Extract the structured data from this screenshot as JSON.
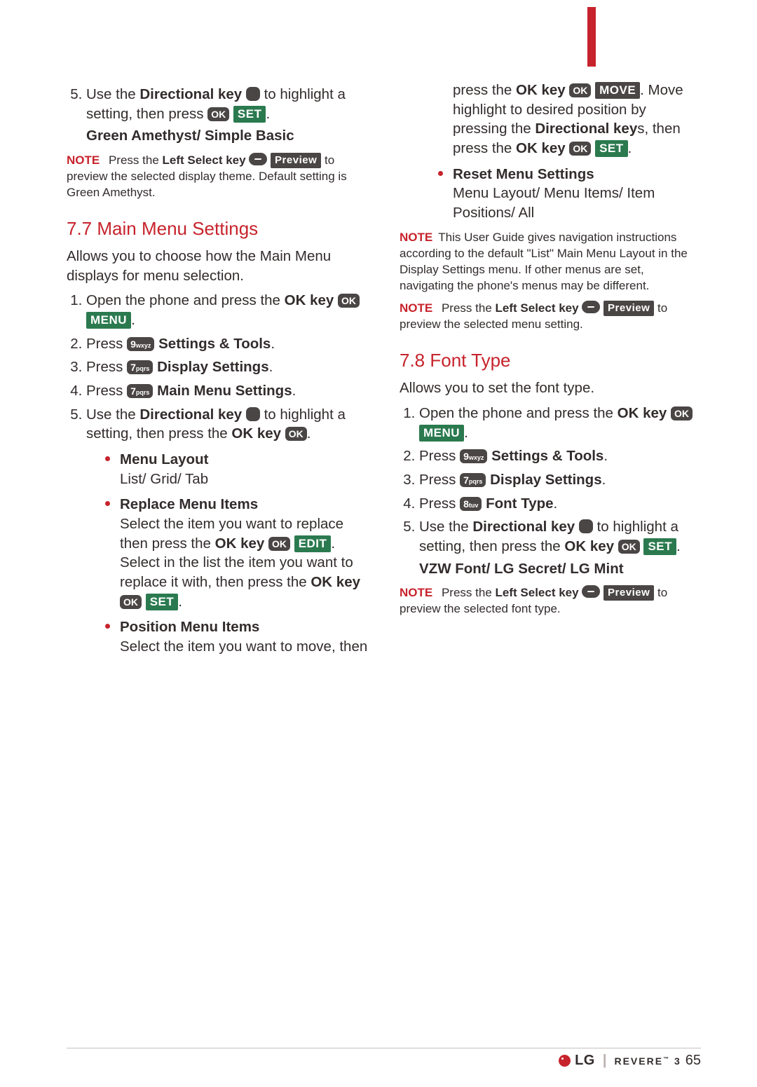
{
  "top_step5": {
    "t1": "Use the ",
    "b1": "Directional key",
    "t2": " to highlight a setting, then press ",
    "sub": "Green Amethyst/ Simple Basic"
  },
  "key": {
    "ok": "OK",
    "k9": "9",
    "s9": "wxyz",
    "k7": "7",
    "s7": "pqrs",
    "k8": "8",
    "s8": "tuv"
  },
  "badge": {
    "set": "SET",
    "menu": "MENU",
    "edit": "EDIT",
    "move": "MOVE",
    "preview": "Preview"
  },
  "note1": {
    "label": "NOTE",
    "t1": "Press the ",
    "b1": "Left Select key",
    "t2": " to preview the selected display theme. Default setting is Green Amethyst."
  },
  "s77": {
    "title": "7.7 Main Menu Settings",
    "intro": "Allows you to choose how the Main Menu displays for menu selection.",
    "st1a": "Open the phone and press the ",
    "st1b": "OK key ",
    "st2a": "Press ",
    "st2b": "Settings & Tools",
    "st3a": "Press ",
    "st3b": "Display Settings",
    "st4a": "Press ",
    "st4b": "Main Menu Settings",
    "st5a": "Use the ",
    "st5b": "Directional key",
    "st5c": " to highlight a setting, then press the ",
    "st5d": "OK key ",
    "b1h": "Menu Layout",
    "b1t": "List/ Grid/ Tab",
    "b2h": "Replace Menu Items",
    "b2t1": "Select the item you want to replace then press the ",
    "b2t2": "OK key ",
    "b2t3": ". Select in the list the item you want to replace it with, then press the ",
    "b2t4": "OK key ",
    "b3h": "Position Menu Items",
    "b3t1": "Select the item you want to move, then press the ",
    "b3t2": "OK key ",
    "b3t3": ". Move highlight to desired position by pressing the ",
    "b3t4": "Directional key",
    "b3t5": "s, then press the ",
    "b3t6": "OK key ",
    "b4h": "Reset Menu Settings",
    "b4t": "Menu Layout/ Menu Items/ Item Positions/ All"
  },
  "note2": {
    "label": "NOTE",
    "text": "This User Guide gives navigation instructions according to the default \"List\" Main Menu Layout in the Display Settings menu. If other menus are set, navigating the phone's menus may be different."
  },
  "note3": {
    "label": "NOTE",
    "t1": "Press the ",
    "b1": "Left Select key",
    "t2": " to preview the selected menu setting."
  },
  "s78": {
    "title": "7.8 Font Type",
    "intro": "Allows you to set the font type.",
    "st1a": "Open the phone and press the ",
    "st1b": "OK key ",
    "st2a": "Press ",
    "st2b": "Settings & Tools",
    "st3a": "Press ",
    "st3b": "Display Settings",
    "st4a": "Press ",
    "st4b": "Font Type",
    "st5a": "Use the ",
    "st5b": "Directional key",
    "st5c": " to highlight a setting, then press the ",
    "st5d": "OK key ",
    "sub": "VZW Font/ LG Secret/ LG Mint"
  },
  "note4": {
    "label": "NOTE",
    "t1": "Press the ",
    "b1": "Left Select key",
    "t2": " to preview the selected font type."
  },
  "footer": {
    "lg": "LG",
    "revere": "REVERE",
    "rev_suffix": "3",
    "page": "65"
  }
}
